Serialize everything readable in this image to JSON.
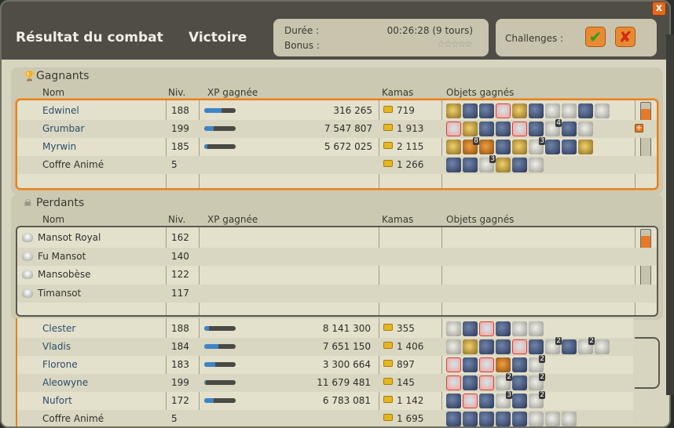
{
  "header": {
    "title": "Résultat du combat",
    "result": "Victoire",
    "duration_label": "Durée :",
    "duration_value": "00:26:28 (9 tours)",
    "bonus_label": "Bonus :",
    "bonus_stars": "☆☆☆☆☆",
    "challenges_label": "Challenges :",
    "challenge_ok": "✔",
    "challenge_ko": "✘",
    "close": "x"
  },
  "columns": {
    "name": "Nom",
    "level": "Niv.",
    "xp": "XP gagnée",
    "kamas": "Kamas",
    "items": "Objets gagnés"
  },
  "winners": {
    "title": "Gagnants",
    "rows": [
      {
        "name": "Edwinel",
        "level": "188",
        "xp": "316 265",
        "xp_fill": 0.55,
        "kamas": "719",
        "items": [
          "gold",
          "blue",
          "blue",
          "hl",
          "gold",
          "blue",
          "grey",
          "grey",
          "blue",
          "grey"
        ]
      },
      {
        "name": "Grumbar",
        "level": "199",
        "xp": "7 547 807",
        "xp_fill": 0.3,
        "kamas": "1 913",
        "items": [
          "hl",
          "gold",
          "blue",
          "blue",
          "hl",
          "blue",
          "grey:4",
          "blue",
          "grey"
        ]
      },
      {
        "name": "Myrwin",
        "level": "185",
        "xp": "5 672 025",
        "xp_fill": 0.1,
        "kamas": "2 115",
        "items": [
          "gold",
          "orange:8",
          "orange",
          "blue",
          "gold",
          "grey:3",
          "blue",
          "blue",
          "gold"
        ]
      },
      {
        "name": "Coffre Animé",
        "level": "5",
        "xp": "",
        "xp_fill": null,
        "kamas": "1 266",
        "items": [
          "blue",
          "blue",
          "grey:3",
          "gold",
          "blue",
          "grey"
        ]
      }
    ]
  },
  "losers": {
    "title": "Perdants",
    "rows": [
      {
        "name": "Mansot Royal",
        "level": "162"
      },
      {
        "name": "Fu Mansot",
        "level": "140"
      },
      {
        "name": "Mansobèse",
        "level": "122"
      },
      {
        "name": "Timansot",
        "level": "117"
      }
    ]
  },
  "overlay_rows": [
    {
      "name": "Clester",
      "level": "188",
      "xp": "8 141 300",
      "xp_fill": 0.15,
      "kamas": "355",
      "items": [
        "grey",
        "blue",
        "hl",
        "blue",
        "grey",
        "grey"
      ]
    },
    {
      "name": "Vladis",
      "level": "184",
      "xp": "7 651 150",
      "xp_fill": 0.45,
      "kamas": "1 406",
      "items": [
        "grey",
        "gold",
        "blue",
        "blue",
        "hl",
        "blue",
        "grey:2",
        "blue",
        "grey:2",
        "grey"
      ]
    },
    {
      "name": "Florone",
      "level": "183",
      "xp": "3 300 664",
      "xp_fill": 0.35,
      "kamas": "897",
      "items": [
        "hl",
        "blue",
        "hl",
        "orange",
        "blue",
        "grey:2"
      ]
    },
    {
      "name": "Aleowyne",
      "level": "199",
      "xp": "11 679 481",
      "xp_fill": 0.05,
      "kamas": "145",
      "items": [
        "hl",
        "blue",
        "hl",
        "grey:2",
        "blue",
        "grey:2"
      ]
    },
    {
      "name": "Nufort",
      "level": "172",
      "xp": "6 783 081",
      "xp_fill": 0.3,
      "kamas": "1 142",
      "items": [
        "blue",
        "hl",
        "blue",
        "grey:3",
        "blue",
        "grey:2"
      ]
    },
    {
      "name": "Coffre Animé",
      "level": "5",
      "xp": "",
      "xp_fill": null,
      "kamas": "1 695",
      "items": [
        "blue",
        "blue",
        "blue",
        "blue",
        "blue",
        "grey",
        "grey",
        "grey"
      ]
    }
  ]
}
